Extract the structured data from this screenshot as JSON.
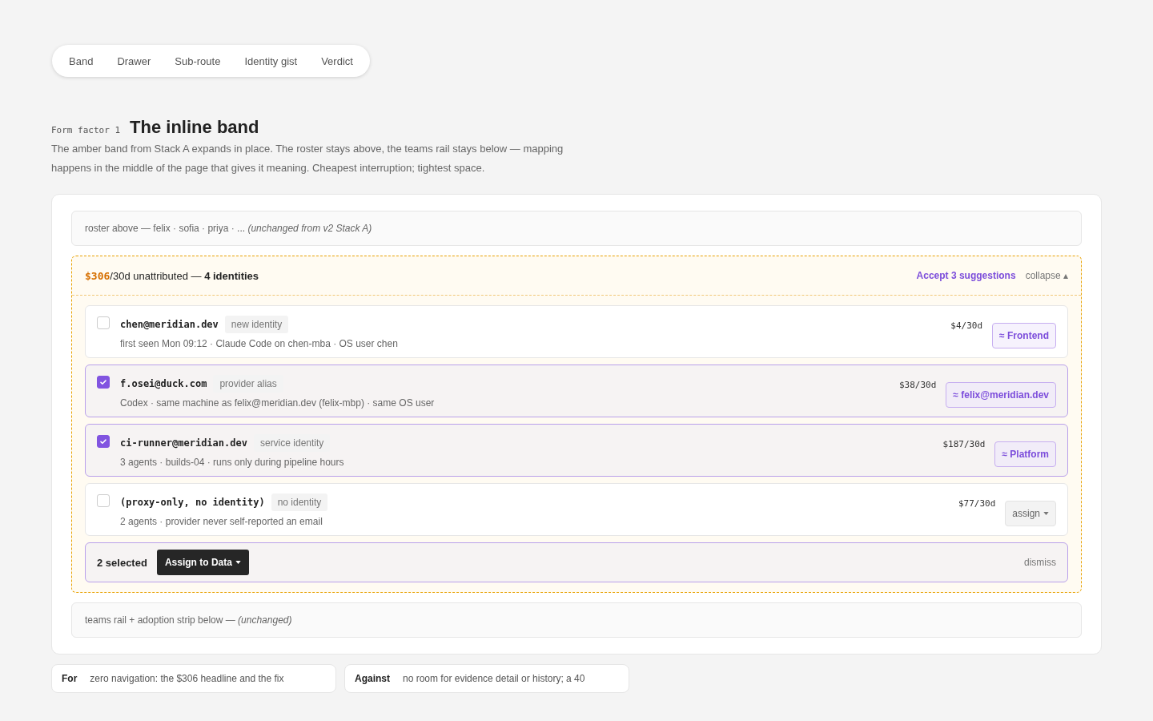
{
  "tabs": [
    "Band",
    "Drawer",
    "Sub-route",
    "Identity gist",
    "Verdict"
  ],
  "section": {
    "eyebrow": "Form factor 1",
    "title": "The inline band",
    "description": "The amber band from Stack A expands in place. The roster stays above, the teams rail stays below — mapping happens in the middle of the page that gives it meaning. Cheapest interruption; tightest space."
  },
  "roster_strip": "roster above — felix · sofia · priya · ... *(unchanged from v2 Stack A)*",
  "band": {
    "amount": "$306",
    "summary": "/30d unattributed — **4 identities**",
    "accept_link": "Accept 3 suggestions",
    "collapse_link": "collapse ▴",
    "rows": [
      {
        "checked": false,
        "identity": "chen@meridian.dev",
        "tag": "new identity",
        "detail": "first seen Mon 09:12 · Claude Code on chen-mba · OS user chen",
        "cost": "$4/30d",
        "action": {
          "kind": "suggestion",
          "label": "≈ Frontend"
        }
      },
      {
        "checked": true,
        "identity": "f.osei@duck.com",
        "tag": "provider alias",
        "detail": "Codex · same machine as felix@meridian.dev (felix-mbp) · same OS user",
        "cost": "$38/30d",
        "action": {
          "kind": "suggestion",
          "label": "≈ felix@meridian.dev"
        }
      },
      {
        "checked": true,
        "identity": "ci-runner@meridian.dev",
        "tag": "service identity",
        "detail": "3 agents · builds-04 · runs only during pipeline hours",
        "cost": "$187/30d",
        "action": {
          "kind": "suggestion",
          "label": "≈ Platform"
        }
      },
      {
        "checked": false,
        "identity": "(proxy-only, no identity)",
        "tag": "no identity",
        "detail": "2 agents · provider never self-reported an email",
        "cost": "$77/30d",
        "action": {
          "kind": "dropdown",
          "label": "assign"
        }
      }
    ],
    "selection_bar": {
      "count": "2 selected",
      "assign_button": "Assign to Data",
      "dismiss": "dismiss"
    }
  },
  "teams_strip": "teams rail + adoption strip below — *(unchanged)*",
  "verdict_cards": [
    {
      "label": "For",
      "text": "zero navigation: the $306 headline and the fix"
    },
    {
      "label": "Against",
      "text": "no room for evidence detail or history; a 40"
    }
  ]
}
